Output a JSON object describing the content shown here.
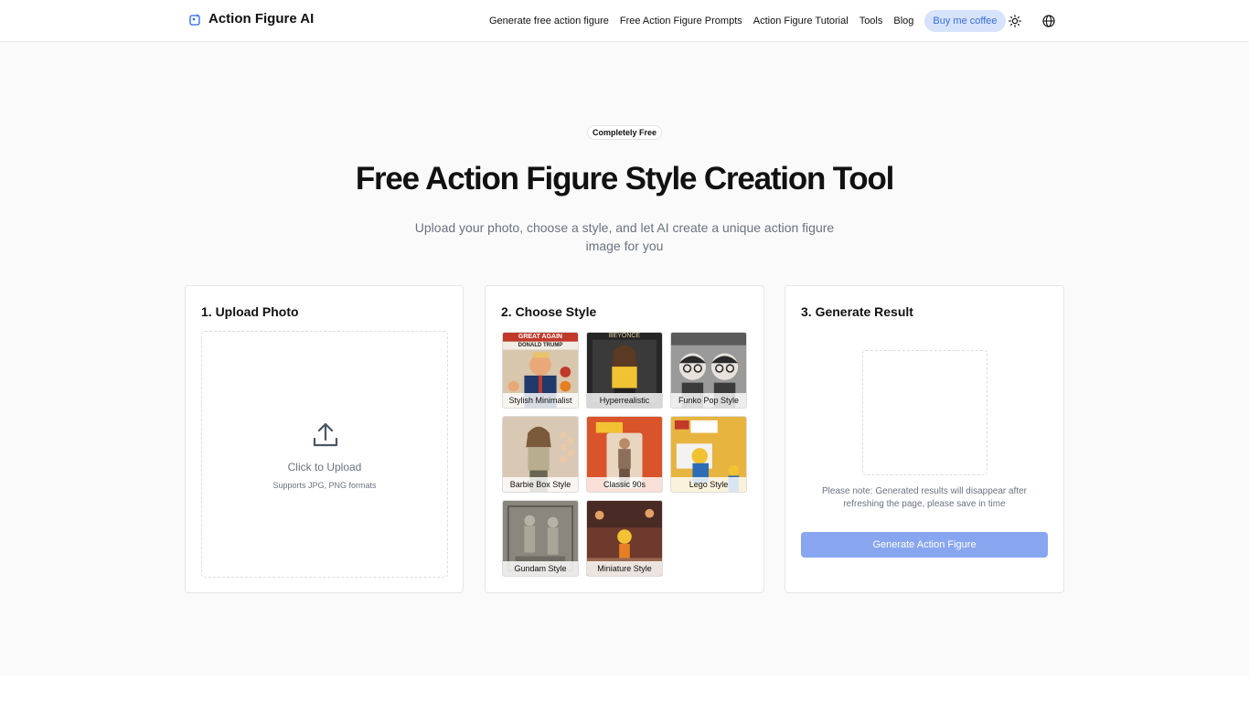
{
  "brand": {
    "name": "Action Figure AI",
    "icon": "image-sparkle-icon"
  },
  "nav": {
    "links": [
      "Generate free action figure",
      "Free Action Figure Prompts",
      "Action Figure Tutorial",
      "Tools",
      "Blog"
    ],
    "coffee_label": "Buy me coffee",
    "icons": [
      "sun-icon",
      "globe-icon"
    ]
  },
  "hero": {
    "badge": "Completely Free",
    "title": "Free Action Figure Style Creation Tool",
    "subtitle": "Upload your photo, choose a style, and let AI create a unique action figure image for you"
  },
  "upload": {
    "heading": "1. Upload Photo",
    "cta": "Click to Upload",
    "hint": "Supports JPG, PNG formats"
  },
  "styles": {
    "heading": "2. Choose Style",
    "items": [
      {
        "label": "Stylish Minimalist",
        "thumb_text_1": "GREAT AGAIN",
        "thumb_text_2": "DONALD TRUMP",
        "color": "#c9a98a"
      },
      {
        "label": "Hyperrealistic",
        "thumb_text_1": "BEYONCÉ",
        "color": "#2b2b2b"
      },
      {
        "label": "Funko Pop Style",
        "color": "#8a8a8a"
      },
      {
        "label": "Barbie Box Style",
        "color": "#c8b29a"
      },
      {
        "label": "Classic 90s",
        "color": "#d9532b"
      },
      {
        "label": "Lego Style",
        "color": "#e7b440"
      },
      {
        "label": "Gundam Style",
        "color": "#7d7a72"
      },
      {
        "label": "Miniature Style",
        "color": "#8a4a3a"
      }
    ]
  },
  "result": {
    "heading": "3. Generate Result",
    "note": "Please note: Generated results will disappear after refreshing the page, please save in time",
    "button": "Generate Action Figure"
  }
}
